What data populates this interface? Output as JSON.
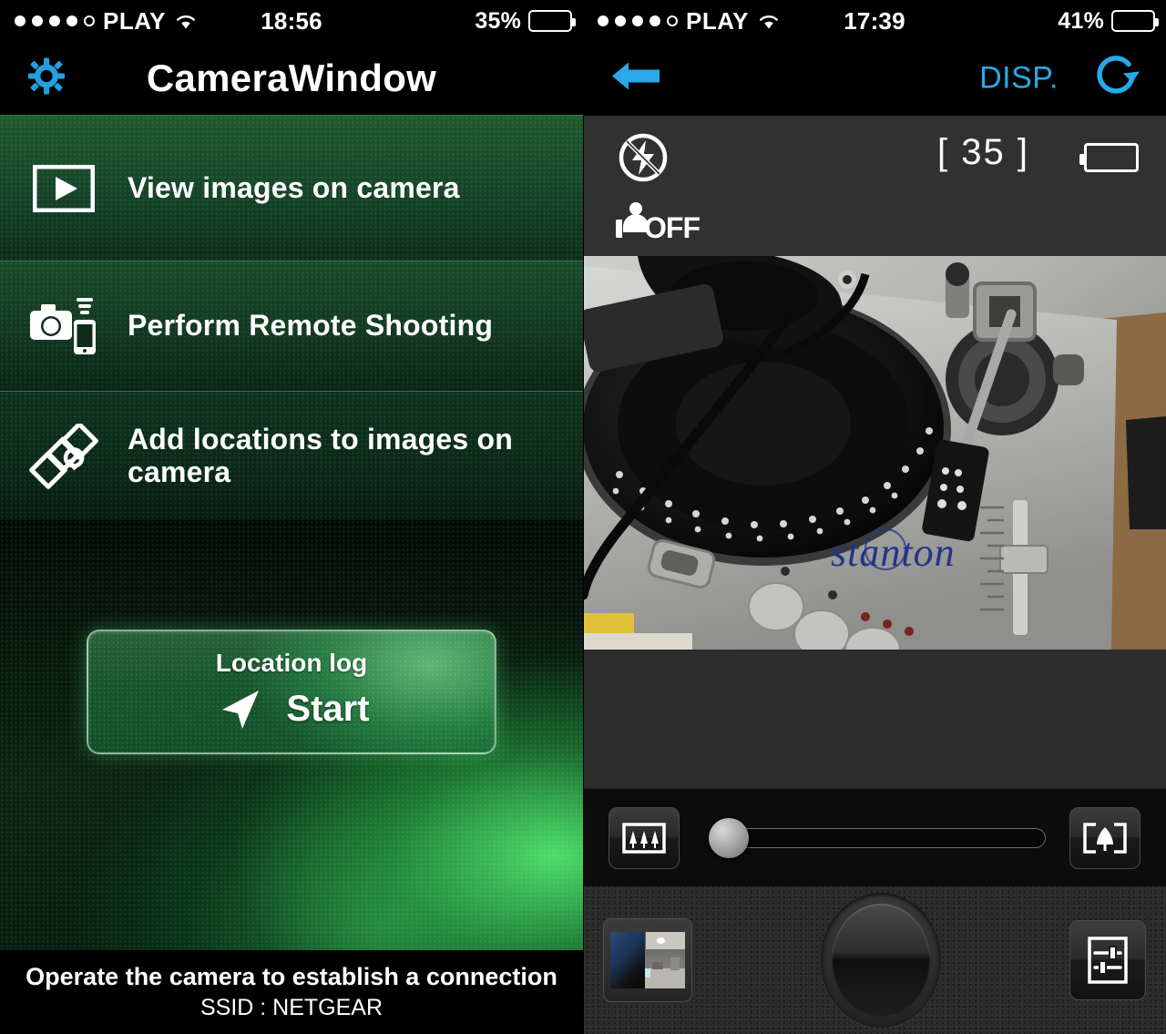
{
  "left_phone": {
    "status_bar": {
      "signal_dots_filled": 4,
      "signal_dots_total": 5,
      "carrier": "PLAY",
      "wifi_icon": "wifi-icon",
      "time": "18:56",
      "battery_percent": "35%",
      "battery_level": 35
    },
    "title_bar": {
      "gear_icon": "gear-icon",
      "title": "CameraWindow",
      "accent_color": "#22a0e0"
    },
    "menu": [
      {
        "icon": "play-box-icon",
        "label": "View images on camera"
      },
      {
        "icon": "camera-phone-icon",
        "label": "Perform Remote Shooting"
      },
      {
        "icon": "satellite-icon",
        "label": "Add locations to images on camera"
      }
    ],
    "location_log": {
      "title": "Location log",
      "arrow_icon": "navigation-arrow-icon",
      "action": "Start"
    },
    "footer": {
      "line1": "Operate the camera to establish a connection",
      "line2": "SSID : NETGEAR"
    }
  },
  "right_phone": {
    "status_bar": {
      "signal_dots_filled": 4,
      "signal_dots_total": 5,
      "carrier": "PLAY",
      "wifi_icon": "wifi-icon",
      "time": "17:39",
      "battery_percent": "41%",
      "battery_level": 41
    },
    "nav_bar": {
      "back_icon": "back-arrow-icon",
      "disp_label": "DISP.",
      "refresh_icon": "refresh-icon",
      "accent_color": "#2aa8e8"
    },
    "info_bar": {
      "flash_icon": "flash-off-icon",
      "self_timer_icon": "self-timer-icon",
      "self_timer_value": "OFF",
      "shots_remaining": "[ 35 ]",
      "battery_icon": "camera-battery-icon"
    },
    "live_view": {
      "subject": "turntable-live-preview",
      "brand_text": "stanton"
    },
    "zoom_bar": {
      "wide_icon": "zoom-wide-icon",
      "tele_icon": "zoom-tele-icon",
      "slider_icon": "zoom-slider",
      "slider_value": 0
    },
    "bottom_bar": {
      "thumbnail_icon": "last-photo-thumbnail",
      "shutter_icon": "shutter-button",
      "settings_icon": "camera-settings-icon"
    }
  }
}
